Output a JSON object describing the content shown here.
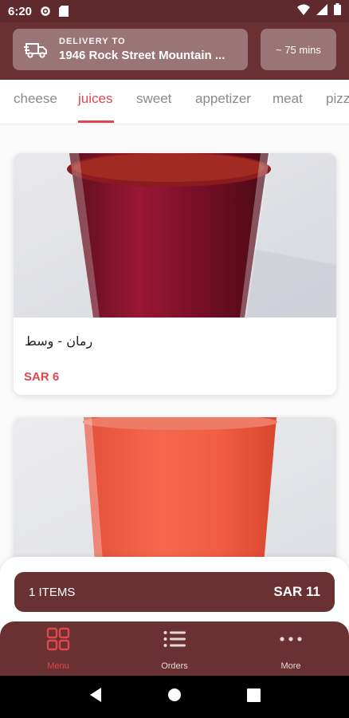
{
  "status_bar": {
    "time": "6:20"
  },
  "header": {
    "delivery_label": "DELIVERY TO",
    "delivery_address": "1946 Rock Street Mountain ...",
    "eta": "~ 75 mins"
  },
  "tabs": [
    {
      "label": "cheese",
      "active": false
    },
    {
      "label": "juices",
      "active": true
    },
    {
      "label": "sweet",
      "active": false
    },
    {
      "label": "appetizer",
      "active": false
    },
    {
      "label": "meat",
      "active": false
    },
    {
      "label": "pizza",
      "active": false
    }
  ],
  "products": [
    {
      "name": "رمان - وسط",
      "price": "SAR 6"
    }
  ],
  "cart": {
    "count_label": "1 ITEMS",
    "total_label": "SAR 11"
  },
  "bottom_nav": [
    {
      "label": "Menu",
      "icon": "grid-icon",
      "active": true
    },
    {
      "label": "Orders",
      "icon": "list-icon",
      "active": false
    },
    {
      "label": "More",
      "icon": "more-dots-icon",
      "active": false
    }
  ],
  "colors": {
    "primary": "#6a3133",
    "accent": "#e0464c",
    "status_bar": "#5e2a2c"
  }
}
